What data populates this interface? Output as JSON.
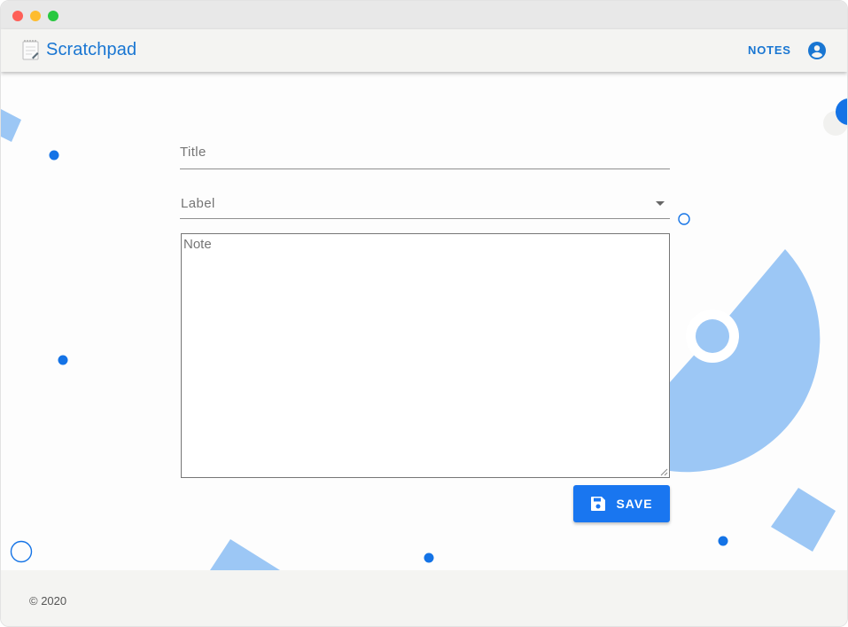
{
  "window": {
    "controls": [
      "close",
      "minimize",
      "maximize"
    ]
  },
  "appbar": {
    "brand_icon": "notepad-icon",
    "title": "Scratchpad",
    "nav_notes": "NOTES",
    "account_icon": "account-circle-icon"
  },
  "form": {
    "title_placeholder": "Title",
    "label_placeholder": "Label",
    "note_placeholder": "Note",
    "save_label": "SAVE",
    "save_icon": "floppy-disk-icon"
  },
  "footer": {
    "copyright": "© 2020"
  },
  "colors": {
    "accent": "#1976d2",
    "button": "#1976f0",
    "decoration_light": "#9cc7f5",
    "decoration_dark": "#1473e6"
  }
}
